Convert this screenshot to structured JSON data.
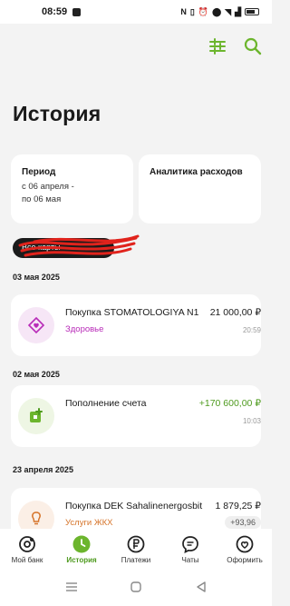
{
  "status_bar": {
    "time": "08:59"
  },
  "page": {
    "title": "История"
  },
  "period_card": {
    "title": "Период",
    "line1": "с 06 апреля -",
    "line2": "по 06 мая"
  },
  "analytics_card": {
    "title": "Аналитика расходов"
  },
  "account_chip": {
    "label": "Все карты"
  },
  "groups": [
    {
      "date": "03 мая 2025",
      "tx": {
        "name": "Покупка STOMATOLOGIYA N1",
        "amount": "21 000,00 ₽",
        "category": "Здоровье",
        "category_color": "#b82bb8",
        "time": "20:59"
      }
    },
    {
      "date": "02 мая 2025",
      "tx": {
        "name": "Пополнение счета",
        "amount": "+170 600,00 ₽",
        "time": "10:03"
      }
    },
    {
      "date": "23 апреля 2025",
      "tx": {
        "name": "Покупка DEK Sahalinenergosbit",
        "amount": "1 879,25 ₽",
        "category": "Услуги ЖКХ",
        "category_color": "#d6742a",
        "cashback": "+93,96"
      }
    }
  ],
  "bottom_nav": [
    {
      "label": "Мой банк",
      "icon": "bank-icon"
    },
    {
      "label": "История",
      "icon": "clock-icon",
      "active": true
    },
    {
      "label": "Платежи",
      "icon": "ruble-icon"
    },
    {
      "label": "Чаты",
      "icon": "chat-icon"
    },
    {
      "label": "Оформить",
      "icon": "heart-icon"
    }
  ],
  "colors": {
    "accent": "#6cb52d",
    "background": "#f3f3f3"
  }
}
